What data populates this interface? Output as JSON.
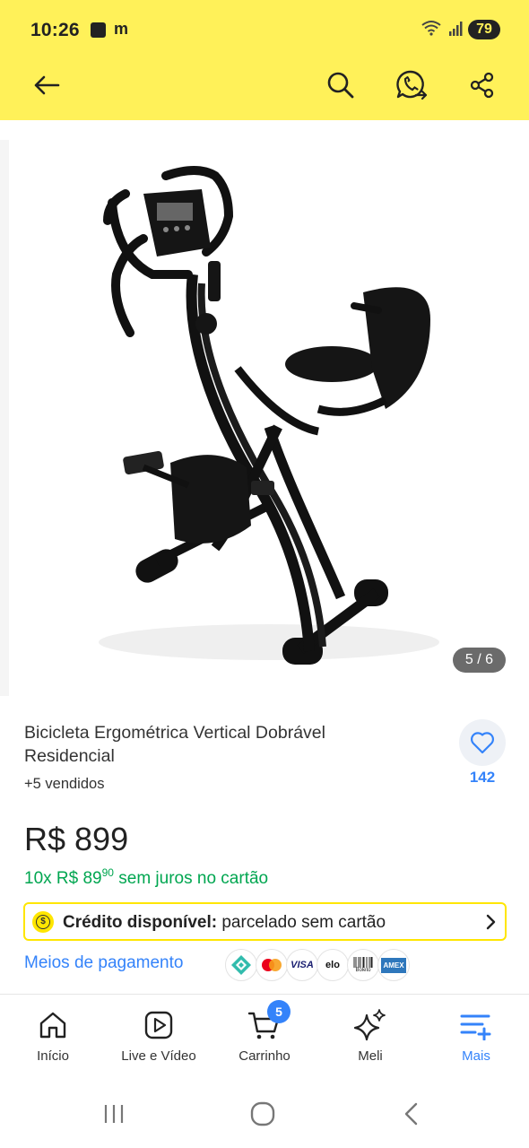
{
  "status_bar": {
    "time": "10:26",
    "notif_m": "m",
    "battery": "79"
  },
  "icons": {
    "back": "arrow-left-icon",
    "search": "search-icon",
    "whatsapp": "whatsapp-share-icon",
    "share": "share-icon",
    "favorite": "heart-icon",
    "chevron": "chevron-right-icon"
  },
  "gallery": {
    "counter": "5 / 6",
    "alt": "Bicicleta ergométrica dobrável preta"
  },
  "product": {
    "title": "Bicicleta Ergométrica Vertical Dobrável Residencial",
    "sold": "+5 vendidos",
    "favorites": "142",
    "price": "R$ 899",
    "installments_prefix": "10x R$ 89",
    "installments_cents": "90",
    "installments_suffix": " sem juros no cartão"
  },
  "credit": {
    "coin": "$",
    "bold": "Crédito disponível:",
    "rest": " parcelado sem cartão"
  },
  "payment": {
    "label": "Meios de pagamento",
    "methods": [
      "Pix",
      "Mastercard",
      "VISA",
      "elo",
      "Boleto",
      "AMEX"
    ]
  },
  "tabs": [
    {
      "label": "Início",
      "icon": "home-icon"
    },
    {
      "label": "Live e Vídeo",
      "icon": "play-icon"
    },
    {
      "label": "Carrinho",
      "icon": "cart-icon",
      "badge": "5"
    },
    {
      "label": "Meli",
      "icon": "sparkle-icon"
    },
    {
      "label": "Mais",
      "icon": "menu-plus-icon",
      "active": true
    }
  ],
  "colors": {
    "brand_yellow": "#fff159",
    "accent_blue": "#3483fa",
    "green": "#00a650"
  }
}
